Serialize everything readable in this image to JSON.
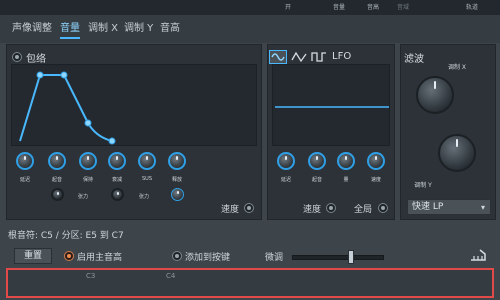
{
  "topbar": {
    "labels": [
      "开",
      "音量",
      "音高",
      "音域",
      "轨道"
    ]
  },
  "tabs": [
    {
      "label": "声像调整",
      "active": false
    },
    {
      "label": "音量",
      "active": true
    },
    {
      "label": "调制 X",
      "active": false
    },
    {
      "label": "调制 Y",
      "active": false
    },
    {
      "label": "音高",
      "active": false
    }
  ],
  "envelope": {
    "title": "包络",
    "knobs": [
      {
        "label": "延迟",
        "value": 0.05
      },
      {
        "label": "起音",
        "value": 0.4
      },
      {
        "label": "保持",
        "value": 0.35
      },
      {
        "label": "衰减",
        "value": 0.75
      },
      {
        "label": "SUS",
        "value": 0.55
      },
      {
        "label": "释放",
        "value": 0.3
      }
    ],
    "tension_knobs": [
      {
        "label": "张力"
      },
      {
        "label": "张力"
      }
    ],
    "speed_label": "速度"
  },
  "lfo": {
    "title": "LFO",
    "knobs": [
      {
        "label": "延迟"
      },
      {
        "label": "起音"
      },
      {
        "label": "量"
      },
      {
        "label": "速度"
      }
    ],
    "speed_label": "速度",
    "global_label": "全局"
  },
  "filter": {
    "title": "滤波",
    "knob_x_label": "调制 X",
    "knob_y_label": "调制 Y",
    "type_select": "快速 LP"
  },
  "bottom": {
    "range_info": "根音符: C5 / 分区: E5 到 C7",
    "reset_label": "重置",
    "use_main_pitch_label": "启用主音高",
    "add_to_key_label": "添加到按键",
    "fine_tune_label": "微调",
    "fine_tune_value": 0.65
  },
  "keyboard": {
    "labels": [
      "C3",
      "C4"
    ]
  },
  "colors": {
    "accent": "#49b8ff",
    "highlight_border": "#e24a4a",
    "orange": "#f08a50"
  }
}
